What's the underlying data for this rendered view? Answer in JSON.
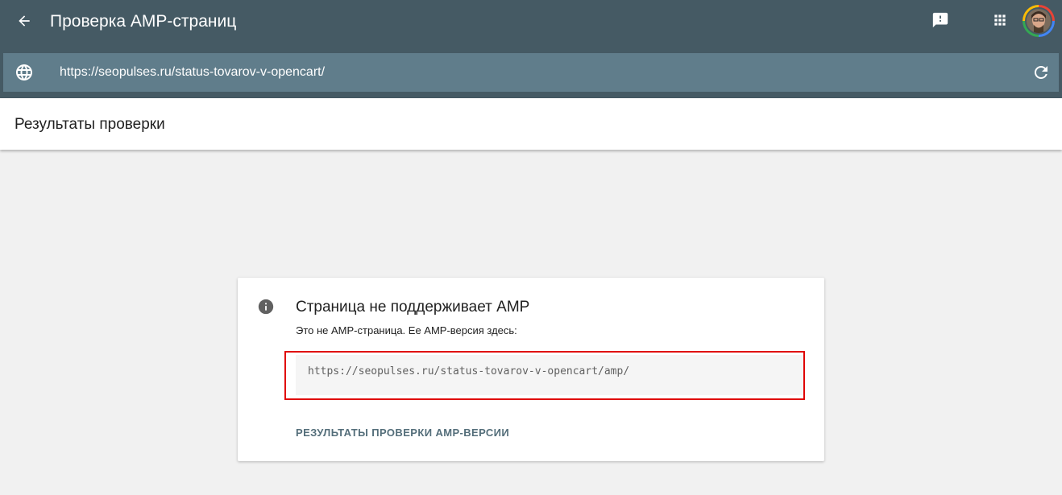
{
  "appbar": {
    "title": "Проверка AMP-страниц",
    "back_icon": "arrow-back-icon",
    "feedback_icon": "feedback-icon",
    "apps_icon": "apps-grid-icon",
    "bg_color": "#455a64"
  },
  "urlbar": {
    "url": "https://seopulses.ru/status-tovarov-v-opencart/",
    "globe_icon": "globe-icon",
    "reload_icon": "reload-icon",
    "bg_color": "#607d8b"
  },
  "subheader": {
    "title": "Результаты проверки"
  },
  "result_card": {
    "title": "Страница не поддерживает AMP",
    "subtitle": "Это не AMP-страница. Ее AMP-версия здесь:",
    "amp_url": "https://seopulses.ru/status-tovarov-v-opencart/amp/",
    "action_label": "РЕЗУЛЬТАТЫ ПРОВЕРКИ AMP-ВЕРСИИ",
    "info_icon": "info-icon",
    "highlight_color": "#e00000"
  }
}
